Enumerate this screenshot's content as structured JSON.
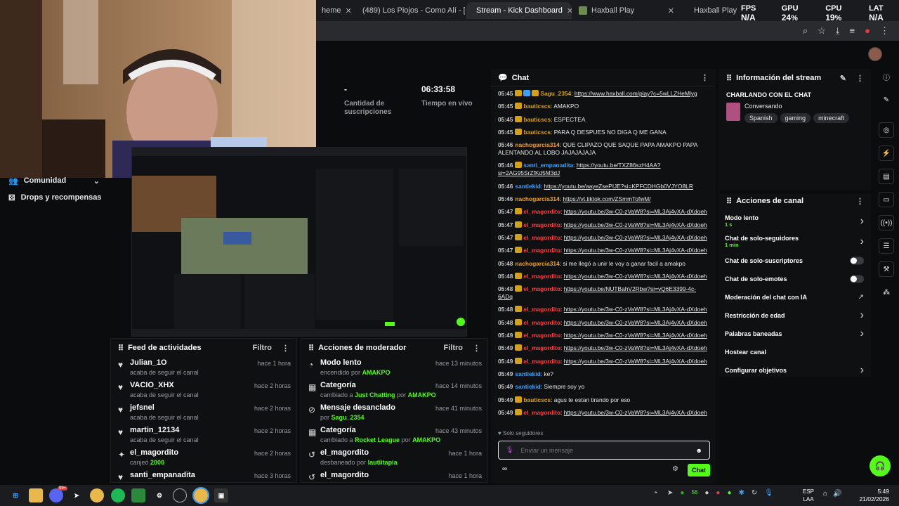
{
  "browser": {
    "tabs": [
      {
        "label": "heme",
        "active": false
      },
      {
        "label": "(489) Los Piojos - Como Alí - [S",
        "active": false
      },
      {
        "label": "Stream - Kick Dashboard",
        "active": true
      },
      {
        "label": "Haxball Play",
        "active": false
      },
      {
        "label": "Haxball Play",
        "active": false
      }
    ]
  },
  "perf": {
    "fps_label": "FPS",
    "fps": "N/A",
    "gpu_label": "GPU",
    "gpu": "24",
    "cpu_label": "CPU",
    "cpu": "19",
    "lat_label": "LAT",
    "lat": "N/A",
    "pct": "%"
  },
  "nav": {
    "community": "Comunidad",
    "drops": "Drops y recompensas"
  },
  "stats": {
    "subs_value": "-",
    "subs_label": "Cantidad de suscripciones",
    "time_value": "06:33:58",
    "time_label": "Tiempo en vivo"
  },
  "activity": {
    "title": "Feed de actividades",
    "filter": "Filtro",
    "items": [
      {
        "name": "Julian_1O",
        "desc": "acaba de seguir el canal",
        "extra": "",
        "time": "hace 1 hora",
        "icon": "heart"
      },
      {
        "name": "VACIO_XHX",
        "desc": "acaba de seguir el canal",
        "extra": "",
        "time": "hace 2 horas",
        "icon": "heart"
      },
      {
        "name": "jefsnel",
        "desc": "acaba de seguir el canal",
        "extra": "",
        "time": "hace 2 horas",
        "icon": "heart"
      },
      {
        "name": "martin_12134",
        "desc": "acaba de seguir el canal",
        "extra": "",
        "time": "hace 2 horas",
        "icon": "heart"
      },
      {
        "name": "el_magordito",
        "desc": "canjeó",
        "extra": "2000",
        "time": "hace 2 horas",
        "icon": "drops"
      },
      {
        "name": "santi_empanadita",
        "desc": "",
        "extra": "",
        "time": "hace 3 horas",
        "icon": "heart"
      }
    ]
  },
  "modactions": {
    "title": "Acciones de moderador",
    "filter": "Filtro",
    "items": [
      {
        "name": "Modo lento",
        "pre": "encendido por",
        "who": "AMAKPO",
        "mid": "",
        "who2": "",
        "time": "hace 13 minutos",
        "icon": "slow"
      },
      {
        "name": "Categoría",
        "pre": "cambiado a",
        "who": "Just Chatting",
        "mid": "por",
        "who2": "AMAKPO",
        "time": "hace 14 minutos",
        "icon": "cat"
      },
      {
        "name": "Mensaje desanclado",
        "pre": "por",
        "who": "Sagu_2354",
        "mid": "",
        "who2": "",
        "time": "hace 41 minutos",
        "icon": "pin"
      },
      {
        "name": "Categoría",
        "pre": "cambiado a",
        "who": "Rocket League",
        "mid": "por",
        "who2": "AMAKPO",
        "time": "hace 43 minutos",
        "icon": "cat"
      },
      {
        "name": "el_magordito",
        "pre": "desbaneado por",
        "who": "lautiitapia",
        "mid": "",
        "who2": "",
        "time": "hace 1 hora",
        "icon": "unban"
      },
      {
        "name": "el_magordito",
        "pre": "",
        "who": "",
        "mid": "",
        "who2": "",
        "time": "hace 1 hora",
        "icon": "unban"
      }
    ]
  },
  "chat": {
    "title": "Chat",
    "messages": [
      {
        "ts": "05:45",
        "user": "Sagu_2354",
        "color": "#d4a017",
        "text": "https://www.haxball.com/play?c=5wLLZHeMlyg",
        "link": true,
        "badges": 3
      },
      {
        "ts": "05:45",
        "user": "bauticscs",
        "color": "#d4a017",
        "text": "AMAKPO",
        "link": false,
        "badges": 1
      },
      {
        "ts": "05:45",
        "user": "bauticscs",
        "color": "#d4a017",
        "text": "ESPECTEA",
        "link": false,
        "badges": 1
      },
      {
        "ts": "05:45",
        "user": "bauticscs",
        "color": "#d4a017",
        "text": "PARA Q DESPUES NO DIGA Q ME GANA",
        "link": false,
        "badges": 1
      },
      {
        "ts": "05:46",
        "user": "nachogarcia314",
        "color": "#f0a020",
        "text": "QUE CLIPAZO QUE SAQUE PAPA AMAKPO PAPA ALENTANDO AL LOBO JAJAJAJAJA",
        "link": false,
        "badges": 0
      },
      {
        "ts": "05:46",
        "user": "santi_empanadita",
        "color": "#3aa0ff",
        "text": "https://youtu.be/TXZ86szH4AA?si=2AG95SrZfKd5M3dJ",
        "link": true,
        "badges": 1
      },
      {
        "ts": "05:46",
        "user": "santiekid",
        "color": "#3aa0ff",
        "text": "https://youtu.be/aayeZsePIJE?si=KPFCDHGb0VJYO8LR",
        "link": true,
        "badges": 0
      },
      {
        "ts": "05:46",
        "user": "nachogarcia314",
        "color": "#f0a020",
        "text": "https://vt.tiktok.com/ZSmmTofwM/",
        "link": true,
        "badges": 0
      },
      {
        "ts": "05:47",
        "user": "el_magordito",
        "color": "#ff3b3b",
        "text": "https://youtu.be/3w-C0-zVaW8?si=ML3Aj4vXA-dXdoeh",
        "link": true,
        "badges": 1
      },
      {
        "ts": "05:47",
        "user": "el_magordito",
        "color": "#ff3b3b",
        "text": "https://youtu.be/3w-C0-zVaW8?si=ML3Aj4vXA-dXdoeh",
        "link": true,
        "badges": 1
      },
      {
        "ts": "05:47",
        "user": "el_magordito",
        "color": "#ff3b3b",
        "text": "https://youtu.be/3w-C0-zVaW8?si=ML3Aj4vXA-dXdoeh",
        "link": true,
        "badges": 1
      },
      {
        "ts": "05:47",
        "user": "el_magordito",
        "color": "#ff3b3b",
        "text": "https://youtu.be/3w-C0-zVaW8?si=ML3Aj4vXA-dXdoeh",
        "link": true,
        "badges": 1
      },
      {
        "ts": "05:48",
        "user": "nachogarcia314",
        "color": "#f0a020",
        "text": "si me llegó a unir le voy a ganar facil a amakpo",
        "link": false,
        "badges": 0
      },
      {
        "ts": "05:48",
        "user": "el_magordito",
        "color": "#ff3b3b",
        "text": "https://youtu.be/3w-C0-zVaW8?si=ML3Aj4vXA-dXdoeh",
        "link": true,
        "badges": 1
      },
      {
        "ts": "05:48",
        "user": "el_magordito",
        "color": "#ff3b3b",
        "text": "https://youtu.be/NUTBahV2Rbw?si=vQ6E3399-4c-6ADq",
        "link": true,
        "badges": 1
      },
      {
        "ts": "05:48",
        "user": "el_magordito",
        "color": "#ff3b3b",
        "text": "https://youtu.be/3w-C0-zVaW8?si=ML3Aj4vXA-dXdoeh",
        "link": true,
        "badges": 1
      },
      {
        "ts": "05:48",
        "user": "el_magordito",
        "color": "#ff3b3b",
        "text": "https://youtu.be/3w-C0-zVaW8?si=ML3Aj4vXA-dXdoeh",
        "link": true,
        "badges": 1
      },
      {
        "ts": "05:49",
        "user": "el_magordito",
        "color": "#ff3b3b",
        "text": "https://youtu.be/3w-C0-zVaW8?si=ML3Aj4vXA-dXdoeh",
        "link": true,
        "badges": 1
      },
      {
        "ts": "05:49",
        "user": "el_magordito",
        "color": "#ff3b3b",
        "text": "https://youtu.be/3w-C0-zVaW8?si=ML3Aj4vXA-dXdoeh",
        "link": true,
        "badges": 1
      },
      {
        "ts": "05:49",
        "user": "el_magordito",
        "color": "#ff3b3b",
        "text": "https://youtu.be/3w-C0-zVaW8?si=ML3Aj4vXA-dXdoeh",
        "link": true,
        "badges": 1
      },
      {
        "ts": "05:49",
        "user": "santiekid",
        "color": "#3aa0ff",
        "text": "ke?",
        "link": false,
        "badges": 0
      },
      {
        "ts": "05:49",
        "user": "santiekid",
        "color": "#3aa0ff",
        "text": "Siempre soy yo",
        "link": false,
        "badges": 0
      },
      {
        "ts": "05:49",
        "user": "bauticscs",
        "color": "#d4a017",
        "text": "agus te estan tirando por eso",
        "link": false,
        "badges": 1
      },
      {
        "ts": "05:49",
        "user": "el_magordito",
        "color": "#ff3b3b",
        "text": "https://youtu.be/3w-C0-zVaW8?si=ML3Aj4vXA-dXdoeh",
        "link": true,
        "badges": 1
      }
    ],
    "solo": "Solo seguidores",
    "placeholder": "Enviar un mensaje",
    "send": "Chat"
  },
  "info": {
    "title": "Información del stream",
    "stream_title": "CHARLANDO CON EL CHAT",
    "category": "Conversando",
    "tags": [
      "Spanish",
      "gaming",
      "minecraft"
    ]
  },
  "channel_actions": {
    "title": "Acciones de canal",
    "items": [
      {
        "label": "Modo lento",
        "sub": "1 s",
        "ctrl": "chevron"
      },
      {
        "label": "Chat de solo-seguidores",
        "sub": "1 min",
        "ctrl": "chevron"
      },
      {
        "label": "Chat de solo-suscriptores",
        "sub": "",
        "ctrl": "toggle"
      },
      {
        "label": "Chat de solo-emotes",
        "sub": "",
        "ctrl": "toggle"
      },
      {
        "label": "Moderación del chat con IA",
        "sub": "",
        "ctrl": "external"
      },
      {
        "label": "Restricción de edad",
        "sub": "",
        "ctrl": "chevron"
      },
      {
        "label": "Palabras baneadas",
        "sub": "",
        "ctrl": "chevron"
      },
      {
        "label": "Hostear canal",
        "sub": "",
        "ctrl": "none"
      },
      {
        "label": "Configurar objetivos",
        "sub": "",
        "ctrl": "chevron"
      }
    ]
  },
  "taskbar": {
    "badge": "99+",
    "tray_num": "56",
    "lang1": "ESP",
    "lang2": "LAA",
    "time": "5:49",
    "date": "21/02/2026"
  },
  "colors": {
    "accent": "#53fc18",
    "bg": "#0b0c0e",
    "panel": "#0f1012"
  }
}
